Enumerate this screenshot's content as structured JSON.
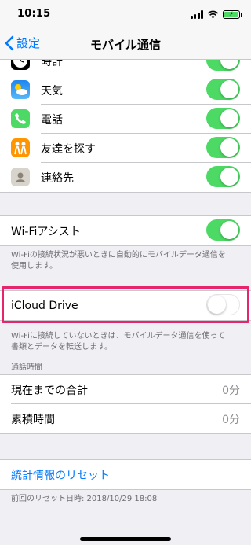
{
  "status_bar": {
    "time": "10:15"
  },
  "nav": {
    "back_label": "設定",
    "title": "モバイル通信"
  },
  "apps": [
    {
      "label": "時計",
      "icon": "clock-icon",
      "enabled": true
    },
    {
      "label": "天気",
      "icon": "weather-icon",
      "enabled": true
    },
    {
      "label": "電話",
      "icon": "phone-icon",
      "enabled": true
    },
    {
      "label": "友達を探す",
      "icon": "find-friends-icon",
      "enabled": true
    },
    {
      "label": "連絡先",
      "icon": "contacts-icon",
      "enabled": true
    }
  ],
  "wifi_assist": {
    "label": "Wi-Fiアシスト",
    "enabled": true,
    "footer_lines": [
      "Wi-Fiの接続状況が悪いときに自動的にモバイルデータ通信を",
      "使用します。"
    ]
  },
  "icloud_drive": {
    "label": "iCloud Drive",
    "enabled": false,
    "footer_lines": [
      "Wi-Fiに接続していないときは、モバイルデータ通信を使って",
      "書類とデータを転送します。"
    ]
  },
  "call_time": {
    "header": "通話時間",
    "rows": [
      {
        "label": "現在までの合計",
        "value": "0分"
      },
      {
        "label": "累積時間",
        "value": "0分"
      }
    ]
  },
  "reset": {
    "label": "統計情報のリセット",
    "last_reset": "前回のリセット日時: 2018/10/29 18:08"
  },
  "colors": {
    "accent": "#007aff",
    "toggle_on": "#4cd964",
    "highlight": "#e5266e"
  }
}
